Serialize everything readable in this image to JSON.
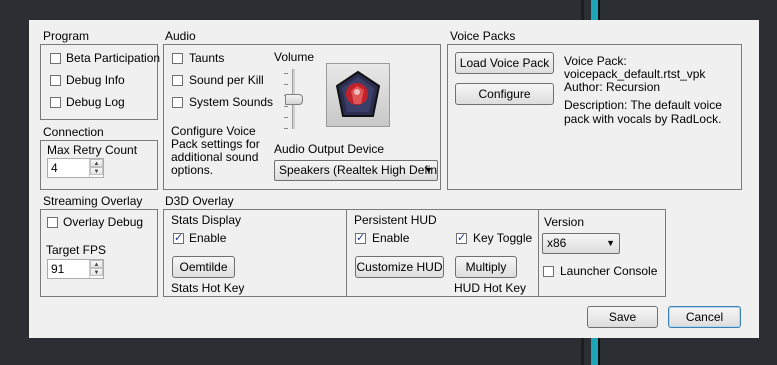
{
  "program": {
    "title": "Program",
    "beta": "Beta Participation",
    "debug_info": "Debug Info",
    "debug_log": "Debug Log"
  },
  "connection": {
    "title": "Connection",
    "max_retry_label": "Max Retry Count",
    "max_retry_value": "4"
  },
  "audio": {
    "title": "Audio",
    "taunts": "Taunts",
    "sound_per_kill": "Sound per Kill",
    "system_sounds": "System Sounds",
    "volume_label": "Volume",
    "volume_level": 0.5,
    "configure_note": "Configure Voice Pack settings for additional sound options.",
    "output_device_label": "Audio Output Device",
    "output_device_value": "Speakers (Realtek High Defin"
  },
  "voice_packs": {
    "title": "Voice Packs",
    "load_button": "Load Voice Pack",
    "configure_button": "Configure",
    "pack_label": "Voice Pack:",
    "pack_file": "voicepack_default.rtst_vpk",
    "author": "Author: Recursion",
    "description": "Description: The default voice pack with vocals by RadLock."
  },
  "streaming_overlay": {
    "title": "Streaming Overlay",
    "overlay_debug": "Overlay Debug",
    "target_fps_label": "Target FPS",
    "target_fps_value": "91"
  },
  "d3d_overlay": {
    "title": "D3D Overlay",
    "stats_display": "Stats Display",
    "enable": "Enable",
    "hotkey_button": "Oemtilde",
    "stats_hotkey": "Stats Hot Key",
    "persistent_hud": "Persistent HUD",
    "hud_enable": "Enable",
    "key_toggle": "Key Toggle",
    "customize_hud": "Customize HUD",
    "multiply": "Multiply",
    "hud_hotkey": "HUD Hot Key"
  },
  "version": {
    "title": "Version",
    "selected": "x86",
    "launcher_console": "Launcher Console"
  },
  "footer": {
    "save": "Save",
    "cancel": "Cancel"
  },
  "colors": {
    "dialog_bg": "#f0f0f0",
    "backdrop": "#2b2f33",
    "accent_teal": "#1fa6b6",
    "icon_red": "#c2212a"
  },
  "icons": [
    "voice-pack-avatar-icon",
    "spin-up-icon",
    "spin-down-icon",
    "dropdown-arrow-icon",
    "checkmark-icon"
  ]
}
